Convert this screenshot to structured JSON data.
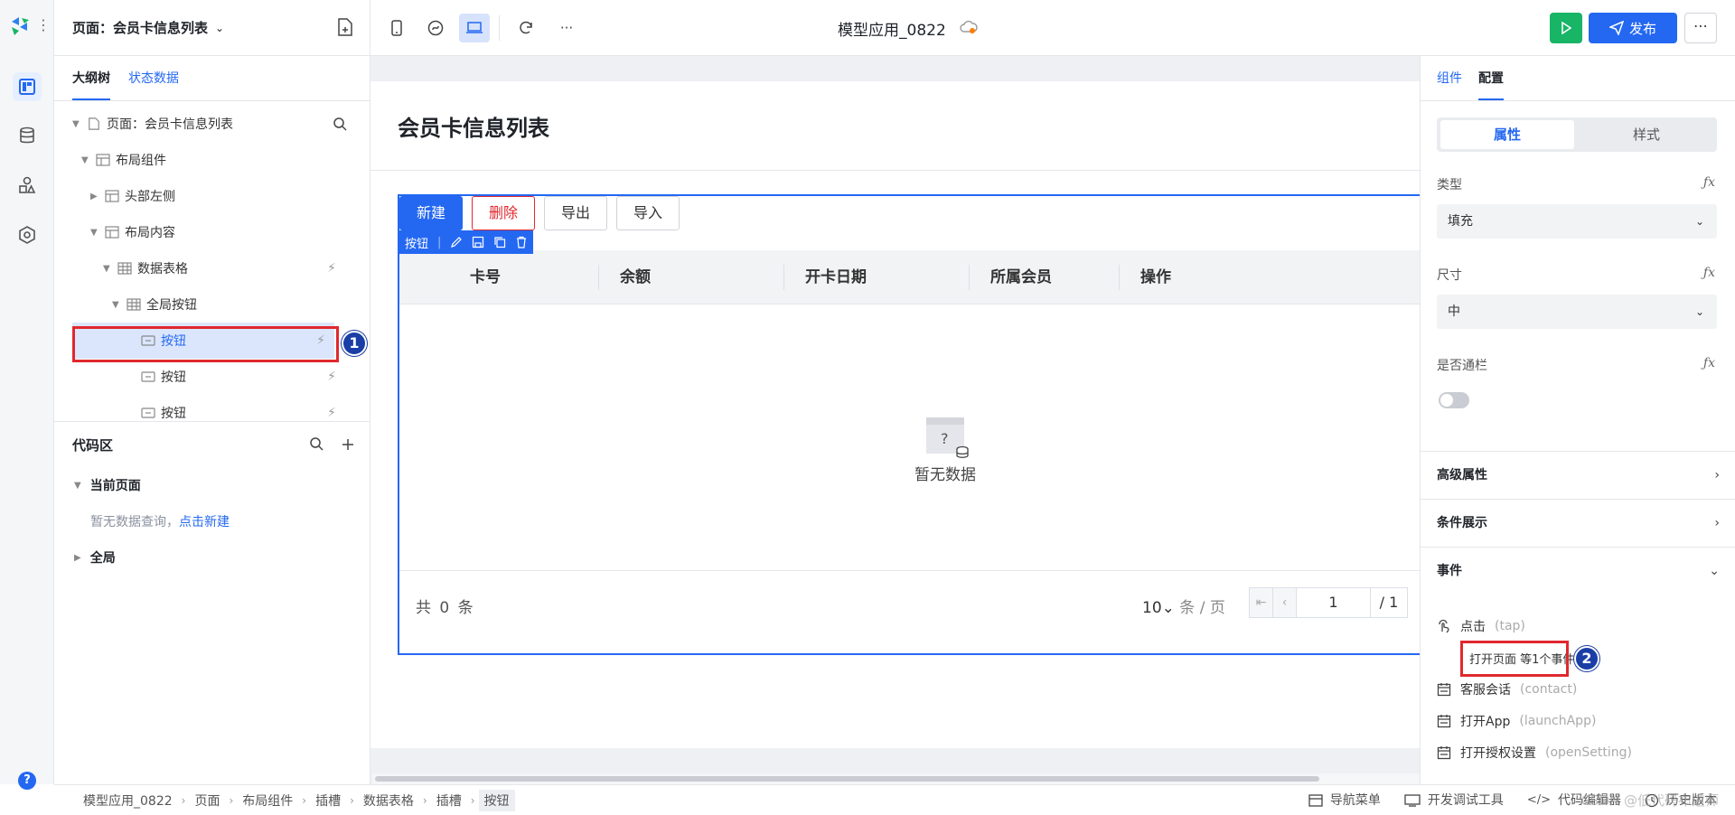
{
  "header": {
    "page_selector": "页面：会员卡信息列表",
    "app_title": "模型应用_0822",
    "publish_label": "发布"
  },
  "left_tabs": [
    "大纲树",
    "状态数据"
  ],
  "tree": [
    {
      "label": "页面：会员卡信息列表"
    },
    {
      "label": "布局组件"
    },
    {
      "label": "头部左侧"
    },
    {
      "label": "布局内容"
    },
    {
      "label": "数据表格"
    },
    {
      "label": "全局按钮"
    },
    {
      "label": "按钮"
    },
    {
      "label": "按钮"
    },
    {
      "label": "按钮"
    }
  ],
  "code_area": {
    "title": "代码区",
    "current_page": "当前页面",
    "empty_text": "暂无数据查询，",
    "new_link": "点击新建",
    "global": "全局"
  },
  "canvas": {
    "page_title": "会员卡信息列表",
    "buttons": [
      "新建",
      "删除",
      "导出",
      "导入"
    ],
    "selection_tag": "按钮",
    "columns": [
      "卡号",
      "余额",
      "开卡日期",
      "所属会员",
      "操作"
    ],
    "empty_text": "暂无数据",
    "total_prefix": "共",
    "total_count": "0",
    "total_suffix": "条",
    "page_size": "10",
    "page_size_unit": "条 / 页",
    "current_page": "1",
    "page_total": "/ 1"
  },
  "right_panel": {
    "tabs": [
      "组件",
      "配置"
    ],
    "segment": [
      "属性",
      "样式"
    ],
    "type_label": "类型",
    "type_value": "填充",
    "size_label": "尺寸",
    "size_value": "中",
    "block_label": "是否通栏",
    "block_value": false,
    "fx": "ƒx",
    "sections": [
      "高级属性",
      "条件展示",
      "事件"
    ],
    "events": [
      {
        "name": "点击",
        "code": "(tap)"
      },
      {
        "name": "客服会话",
        "code": "(contact)"
      },
      {
        "name": "打开App",
        "code": "(launchApp)"
      },
      {
        "name": "打开授权设置",
        "code": "(openSetting)"
      }
    ],
    "tap_action": "打开页面 等1个事件"
  },
  "annotations": {
    "badge1": "1",
    "badge2": "2"
  },
  "breadcrumb": [
    "模型应用_0822",
    "页面",
    "布局组件",
    "插槽",
    "数据表格",
    "插槽",
    "按钮"
  ],
  "bottom_tools": [
    "导航菜单",
    "开发调试工具",
    "代码编辑器",
    "历史版本"
  ],
  "watermark": "CSDN @低代码布道师",
  "colors": {
    "accent": "#2468f2",
    "run": "#18b566",
    "annotation_red": "#e0282e",
    "badge": "#1a3ea6"
  }
}
